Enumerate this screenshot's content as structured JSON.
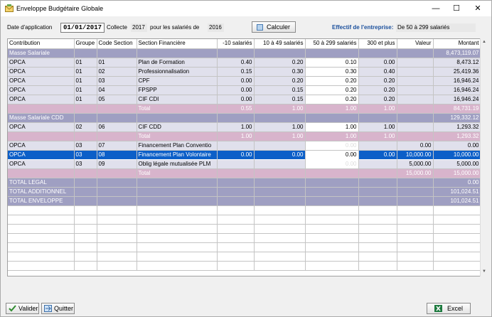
{
  "window": {
    "title": "Enveloppe Budgétaire Globale",
    "minimize_label": "—",
    "maximize_label": "☐",
    "close_label": "✕"
  },
  "toolbar": {
    "date_label": "Date d'application",
    "date_value": "01/01/2017",
    "collecte_label": "Collecte",
    "collecte_year": "2017",
    "salaries_label": "pour les salariés de",
    "salaries_year": "2016",
    "calculer_label": "Calculer",
    "effectif_label": "Effectif de l'entreprise:",
    "effectif_value": "De 50 à 299 salariés"
  },
  "table": {
    "headers": [
      "Contribution",
      "Groupe",
      "Code Section",
      "Section Financière",
      "-10 salariés",
      "10 à 49 salariés",
      "50 à 299 salariés",
      "300 et plus",
      "Valeur",
      "Montant"
    ],
    "rows": [
      {
        "type": "sec",
        "cells": [
          "Masse Salariale",
          "",
          "",
          "",
          "",
          "",
          "",
          "",
          "",
          "8,473,119.07"
        ]
      },
      {
        "type": "row",
        "cells": [
          "OPCA",
          "01",
          "01",
          "Plan de Formation",
          "0.40",
          "0.20",
          "0.10",
          "0.00",
          "",
          "8,473.12"
        ]
      },
      {
        "type": "row",
        "cells": [
          "OPCA",
          "01",
          "02",
          "Professionnalisation",
          "0.15",
          "0.30",
          "0.30",
          "0.40",
          "",
          "25,419.36"
        ]
      },
      {
        "type": "row",
        "cells": [
          "OPCA",
          "01",
          "03",
          "CPF",
          "0.00",
          "0.20",
          "0.20",
          "0.20",
          "",
          "16,946.24"
        ]
      },
      {
        "type": "row",
        "cells": [
          "OPCA",
          "01",
          "04",
          "FPSPP",
          "0.00",
          "0.15",
          "0.20",
          "0.20",
          "",
          "16,946.24"
        ]
      },
      {
        "type": "row",
        "cells": [
          "OPCA",
          "01",
          "05",
          "CIF CDI",
          "0.00",
          "0.15",
          "0.20",
          "0.20",
          "",
          "16,946.24"
        ]
      },
      {
        "type": "total",
        "cells": [
          "",
          "",
          "",
          "Total",
          "0.55",
          "1.00",
          "1.00",
          "1.00",
          "",
          "84,731.19"
        ]
      },
      {
        "type": "sec",
        "cells": [
          "Masse Salariale CDD",
          "",
          "",
          "",
          "",
          "",
          "",
          "",
          "",
          "129,332.12"
        ]
      },
      {
        "type": "row",
        "cells": [
          "OPCA",
          "02",
          "06",
          "CIF CDD",
          "1.00",
          "1.00",
          "1.00",
          "1.00",
          "",
          "1,293.32"
        ]
      },
      {
        "type": "total",
        "cells": [
          "",
          "",
          "",
          "Total",
          "1.00",
          "1.00",
          "1.00",
          "1.00",
          "",
          "1,293.32"
        ]
      },
      {
        "type": "row",
        "cells": [
          "OPCA",
          "03",
          "07",
          "Financement Plan Conventio",
          "",
          "",
          "0.00",
          "",
          "0.00",
          "0.00"
        ]
      },
      {
        "type": "sel",
        "cells": [
          "OPCA",
          "03",
          "08",
          "Financement Plan Volontaire",
          "0.00",
          "0.00",
          "0.00",
          "0.00",
          "10,000.00",
          "10,000.00"
        ]
      },
      {
        "type": "row",
        "cells": [
          "OPCA",
          "03",
          "09",
          "Oblig légale mutualisée PLM",
          "",
          "",
          "0.00",
          "",
          "5,000.00",
          "5,000.00"
        ]
      },
      {
        "type": "total",
        "cells": [
          "",
          "",
          "",
          "Total",
          "",
          "",
          "",
          "",
          "15,000.00",
          "15,000.00"
        ]
      },
      {
        "type": "sec",
        "cells": [
          "TOTAL LEGAL",
          "",
          "",
          "",
          "",
          "",
          "",
          "",
          "",
          "0.00"
        ]
      },
      {
        "type": "sec",
        "cells": [
          "TOTAL ADDITIONNEL",
          "",
          "",
          "",
          "",
          "",
          "",
          "",
          "",
          "101,024.51"
        ]
      },
      {
        "type": "sec",
        "cells": [
          "TOTAL ENVELOPPE",
          "",
          "",
          "",
          "",
          "",
          "",
          "",
          "",
          "101,024.51"
        ]
      }
    ]
  },
  "footer": {
    "valider_label": "Valider",
    "quitter_label": "Quitter",
    "excel_label": "Excel"
  },
  "colors": {
    "section_row": "#9f9fc2",
    "data_row": "#e0e0ec",
    "total_row": "#d8b4cc",
    "selected_row": "#0c5fc8",
    "effectif_label": "#1a4f9c"
  }
}
